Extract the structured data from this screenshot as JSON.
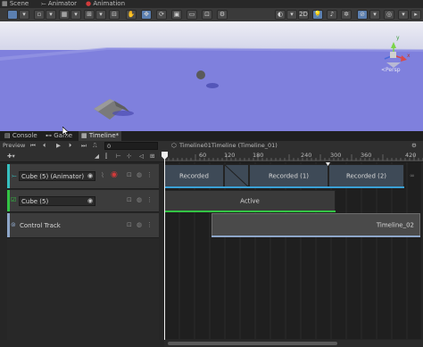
{
  "top_tabs": {
    "scene": "Scene",
    "animator": "Animator",
    "animation": "Animation"
  },
  "scene_toolbar": {
    "mode_2d": "2D",
    "axis_y": "y",
    "axis_x": "x",
    "persp_label": "<Persp"
  },
  "panel_tabs": {
    "console": "Console",
    "game": "Game",
    "timeline": "Timeline*"
  },
  "timeline": {
    "preview_label": "Preview",
    "frame_value": "0",
    "breadcrumb": "Timeline01Timeline (Timeline_01)",
    "ruler": [
      "60",
      "120",
      "180",
      "240",
      "300",
      "360",
      "420"
    ],
    "tracks": [
      {
        "name": "Cube (5) (Animator)",
        "accent": "#36c0c0"
      },
      {
        "name": "Cube (5)",
        "accent": "#33c444"
      },
      {
        "name": "Control Track",
        "accent": "#8ea6c8"
      }
    ],
    "clips": {
      "recorded_0": "Recorded",
      "recorded_1": "Recorded (1)",
      "recorded_2": "Recorded (2)",
      "active": "Active",
      "control": "Timeline_02"
    }
  },
  "colors": {
    "scene_sky": "#7f80dd",
    "ground": "#7779ee",
    "accent_blue": "#5b7fb0",
    "record_red": "#d23a3a"
  }
}
